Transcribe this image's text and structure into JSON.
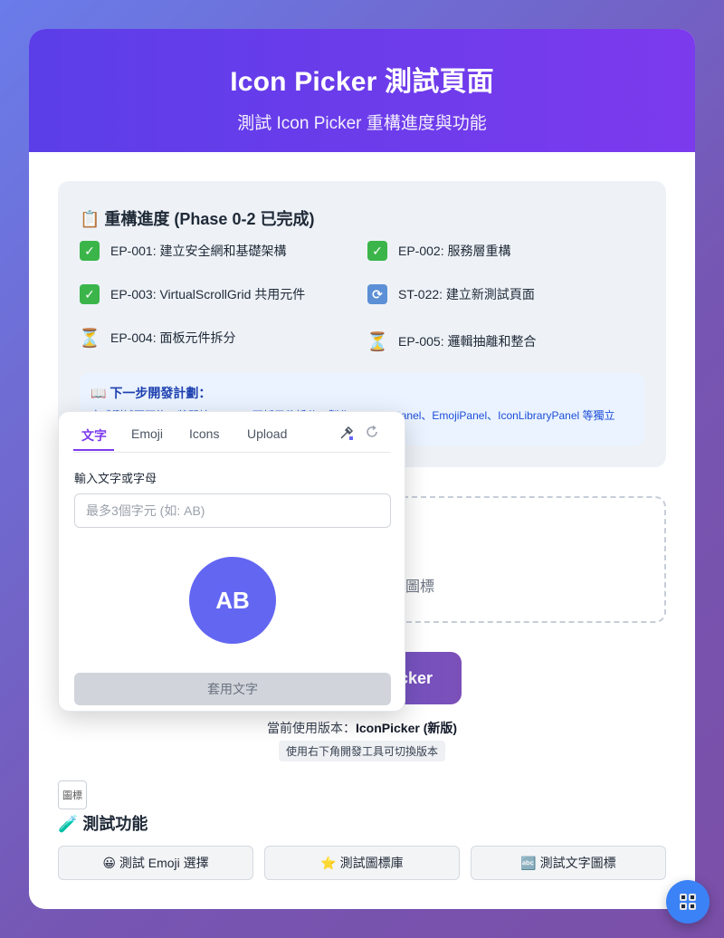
{
  "header": {
    "title": "Icon Picker 測試頁面",
    "subtitle": "測試 Icon Picker 重構進度與功能"
  },
  "progress": {
    "title": "📋 重構進度 (Phase 0-2 已完成)",
    "tasks": [
      {
        "status": "done",
        "icon": "check-icon",
        "label": "EP-001: 建立安全網和基礎架構"
      },
      {
        "status": "done",
        "icon": "check-icon",
        "label": "EP-002: 服務層重構"
      },
      {
        "status": "done",
        "icon": "check-icon",
        "label": "EP-003: VirtualScrollGrid 共用元件"
      },
      {
        "status": "in-progress",
        "icon": "sync-icon",
        "label": "ST-022: 建立新測試頁面"
      },
      {
        "status": "pending",
        "icon": "hourglass-icon",
        "label": "EP-004: 面板元件拆分"
      },
      {
        "status": "pending",
        "icon": "hourglass-icon",
        "label": "EP-005: 邏輯抽離和整合"
      }
    ],
    "next": {
      "title": "📖 下一步開發計劃：",
      "desc": "完成測試頁面後，將開始 EP-004 面板元件拆分，製作 TextIconPanel、EmojiPanel、IconLibraryPanel 等獨立"
    }
  },
  "preview": {
    "dropzone_text": "圖標",
    "open_button": "cker"
  },
  "version": {
    "prefix": "當前使用版本：",
    "name": "IconPicker (新版)",
    "hint": "使用右下角開發工具可切換版本"
  },
  "icon_placeholder": "圖標",
  "features": {
    "title": "🧪 測試功能",
    "buttons": [
      "😀 測試 Emoji 選擇",
      "⭐ 測試圖標庫",
      "🔤 測試文字圖標"
    ]
  },
  "picker": {
    "tabs": [
      "文字",
      "Emoji",
      "Icons",
      "Upload"
    ],
    "active_tab": "文字",
    "input_label": "輸入文字或字母",
    "input_placeholder": "最多3個字元 (如: AB)",
    "preview_text": "AB",
    "apply_label": "套用文字",
    "tools": [
      "eyedropper-icon",
      "reset-icon"
    ]
  },
  "colors": {
    "accent": "#7c3aed",
    "avatar": "#6366f1",
    "devtool": "#3b82f6"
  }
}
